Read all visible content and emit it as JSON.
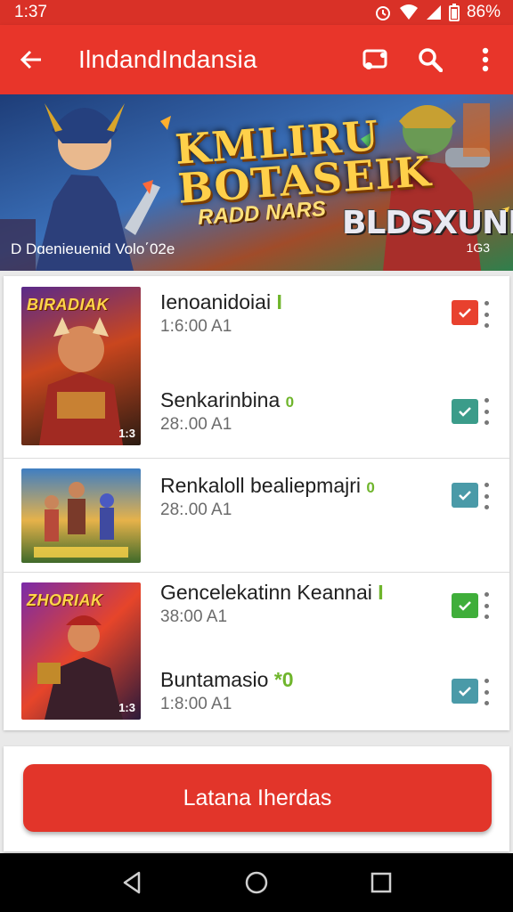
{
  "status_bar": {
    "time": "1:37",
    "battery": "86%",
    "icons": [
      "alarm-icon",
      "wifi-icon",
      "signal-icon",
      "battery-icon"
    ]
  },
  "app_bar": {
    "title": "IlndandIndansia",
    "icons": [
      "back-arrow-icon",
      "cast-icon",
      "search-icon",
      "more-vert-icon"
    ]
  },
  "banner": {
    "title_line1": "KMLIRU",
    "title_line2": "BOTASEIK",
    "subtitle": "RADD NARS",
    "logo_text": "BLDSXUNEY",
    "caption": "D Dɑenieuenid Volo΄02e",
    "badge": "1G3"
  },
  "list": {
    "items": [
      {
        "title": "Ienoanidoiai",
        "flag": "I",
        "subtitle": "1:6:00  A1",
        "check_color": "#e8412e",
        "check_icon": "clipboard-check-icon"
      },
      {
        "title": "Senkarinbina",
        "flag": "0",
        "subtitle": "28:.00  A1",
        "check_color": "#3b9c8a",
        "check_icon": "check-icon"
      },
      {
        "title": "Renkaloll bealiepmajri",
        "flag": "0",
        "subtitle": "28:.00  A1",
        "check_color": "#4a9aa8",
        "check_icon": "check-icon"
      },
      {
        "title": "Gencelekatinn Keannai",
        "flag": "I",
        "subtitle": "38:00  A1",
        "check_color": "#3fae3a",
        "check_icon": "check-icon"
      },
      {
        "title": "Buntamasio",
        "flag": "*0",
        "subtitle": "1:8:00  A1",
        "check_color": "#4a9aa8",
        "check_icon": "clipboard-check-icon"
      }
    ],
    "thumbs": [
      {
        "label": "BIRADIAK",
        "badge": "1:3"
      },
      {
        "label": "",
        "badge": ""
      },
      {
        "label": "ZHORIAK",
        "badge": "1:3"
      }
    ]
  },
  "cta": {
    "label": "Latana Iherdas"
  },
  "nav_bar": {
    "icons": [
      "nav-back-icon",
      "nav-home-icon",
      "nav-recents-icon"
    ]
  },
  "colors": {
    "accent": "#e8352a",
    "status_bar": "#d93127",
    "flag_green": "#6fb52c"
  }
}
